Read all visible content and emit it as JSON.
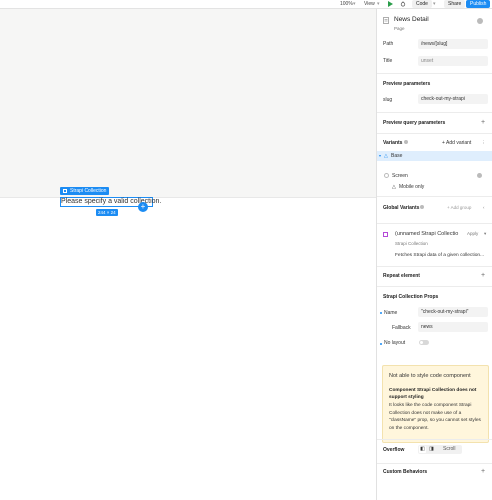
{
  "toolbar": {
    "zoom": "100%",
    "view_label": "View",
    "code_label": "Code",
    "share_label": "Share",
    "publish_label": "Publish"
  },
  "canvas": {
    "selection_label": "Strapi Collection",
    "selection_text": "Please specify a valid collection.",
    "selection_size": "244 × 24",
    "add_symbol": "+"
  },
  "panel": {
    "component_title": "News Detail",
    "component_type": "Page",
    "path_label": "Path",
    "path_value": "/news/[slug]",
    "title_label": "Title",
    "title_value": "unset",
    "preview_params_title": "Preview parameters",
    "slug_label": "slug",
    "slug_value": "check-out-my-strapi",
    "preview_query_title": "Preview query parameters",
    "variants_title": "Variants",
    "add_variant_label": "+ Add variant",
    "base_label": "Base",
    "screen_label": "Screen",
    "mobile_only_label": "Mobile only",
    "global_variants_title": "Global Variants",
    "add_group_label": "+ Add group",
    "collection_name": "(unnamed Strapi Collectio",
    "apply_label": "Apply",
    "collection_type": "Strapi Collection",
    "collection_desc": "Fetches Strapi data of a given collection...",
    "repeat_element_title": "Repeat element",
    "props_title": "Strapi Collection Props",
    "name_label": "Name",
    "name_value": "\"check-out-my-strapi\"",
    "fallback_label": "Fallback",
    "fallback_value": "news",
    "no_layout_label": "No layout",
    "warning": {
      "title": "Not able to style code component",
      "subtitle": "Component Strapi Collection does not support styling",
      "body": "It looks like the code component Strapi Collection does not make use of a \"className\" prop, so you cannot set styles on the component."
    },
    "overflow_title": "Overflow",
    "scroll_label": "Scroll",
    "custom_behaviors_title": "Custom Behaviors"
  },
  "colors": {
    "accent": "#1c8cf3",
    "warning_bg": "#fff6dc",
    "canvas_bg": "#f6f6f5"
  }
}
